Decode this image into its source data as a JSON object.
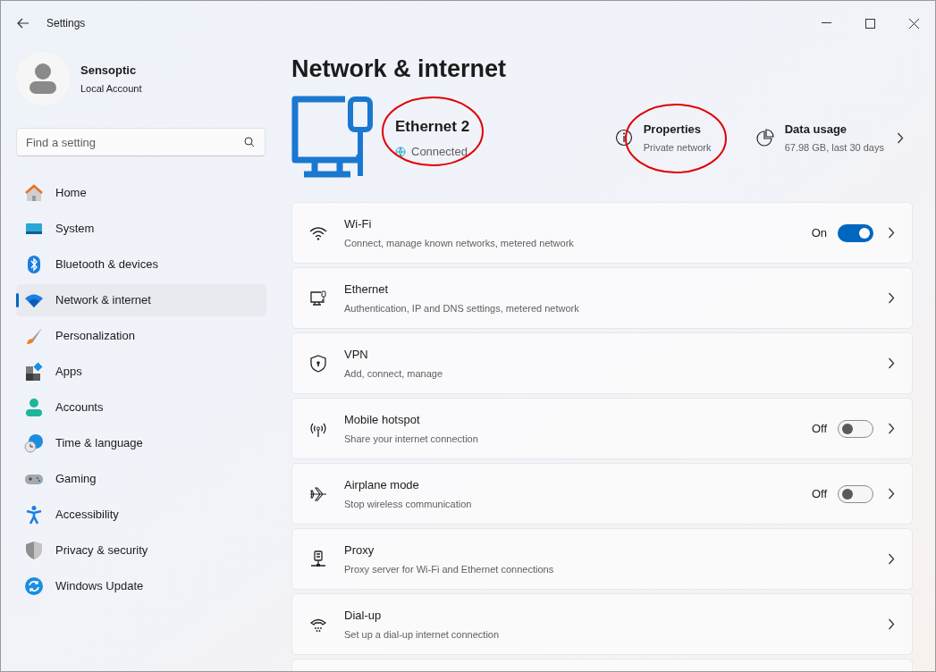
{
  "window": {
    "title": "Settings"
  },
  "account": {
    "name": "Sensoptic",
    "type": "Local Account"
  },
  "search": {
    "placeholder": "Find a setting"
  },
  "sidebar": {
    "items": [
      {
        "label": "Home",
        "selected": false
      },
      {
        "label": "System",
        "selected": false
      },
      {
        "label": "Bluetooth & devices",
        "selected": false
      },
      {
        "label": "Network & internet",
        "selected": true
      },
      {
        "label": "Personalization",
        "selected": false
      },
      {
        "label": "Apps",
        "selected": false
      },
      {
        "label": "Accounts",
        "selected": false
      },
      {
        "label": "Time & language",
        "selected": false
      },
      {
        "label": "Gaming",
        "selected": false
      },
      {
        "label": "Accessibility",
        "selected": false
      },
      {
        "label": "Privacy & security",
        "selected": false
      },
      {
        "label": "Windows Update",
        "selected": false
      }
    ]
  },
  "page_title": "Network & internet",
  "connection": {
    "name": "Ethernet 2",
    "status": "Connected",
    "circled": true
  },
  "properties": {
    "title": "Properties",
    "subtitle": "Private network",
    "circled": true
  },
  "data_usage": {
    "title": "Data usage",
    "subtitle": "67.98 GB, last 30 days",
    "circled": false
  },
  "settings": [
    {
      "kind": "toggle",
      "title": "Wi-Fi",
      "subtitle": "Connect, manage known networks, metered network",
      "on": true,
      "state": "On"
    },
    {
      "kind": "link",
      "title": "Ethernet",
      "subtitle": "Authentication, IP and DNS settings, metered network"
    },
    {
      "kind": "link",
      "title": "VPN",
      "subtitle": "Add, connect, manage"
    },
    {
      "kind": "toggle",
      "title": "Mobile hotspot",
      "subtitle": "Share your internet connection",
      "on": false,
      "state": "Off"
    },
    {
      "kind": "toggle",
      "title": "Airplane mode",
      "subtitle": "Stop wireless communication",
      "on": false,
      "state": "Off"
    },
    {
      "kind": "link",
      "title": "Proxy",
      "subtitle": "Proxy server for Wi-Fi and Ethernet connections"
    },
    {
      "kind": "link",
      "title": "Dial-up",
      "subtitle": "Set up a dial-up internet connection"
    }
  ]
}
